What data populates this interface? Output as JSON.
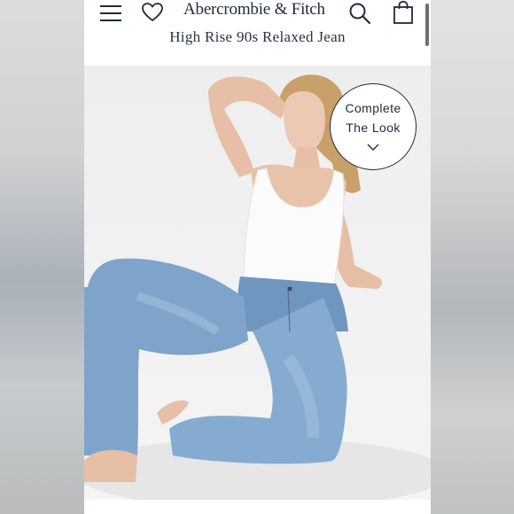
{
  "header": {
    "brand": "Abercrombie & Fitch",
    "menu_icon": "hamburger-menu-icon",
    "wishlist_icon": "heart-icon",
    "search_icon": "search-icon",
    "bag_icon": "shopping-bag-icon"
  },
  "product": {
    "title": "High Rise 90s Relaxed Jean"
  },
  "complete_look": {
    "line1": "Complete",
    "line2": "The Look",
    "icon": "chevron-down-icon"
  },
  "colors": {
    "navy_text": "#1f2a3c",
    "denim": "#7aa0c6",
    "tank": "#ffffff",
    "background": "#f1f1f1"
  }
}
